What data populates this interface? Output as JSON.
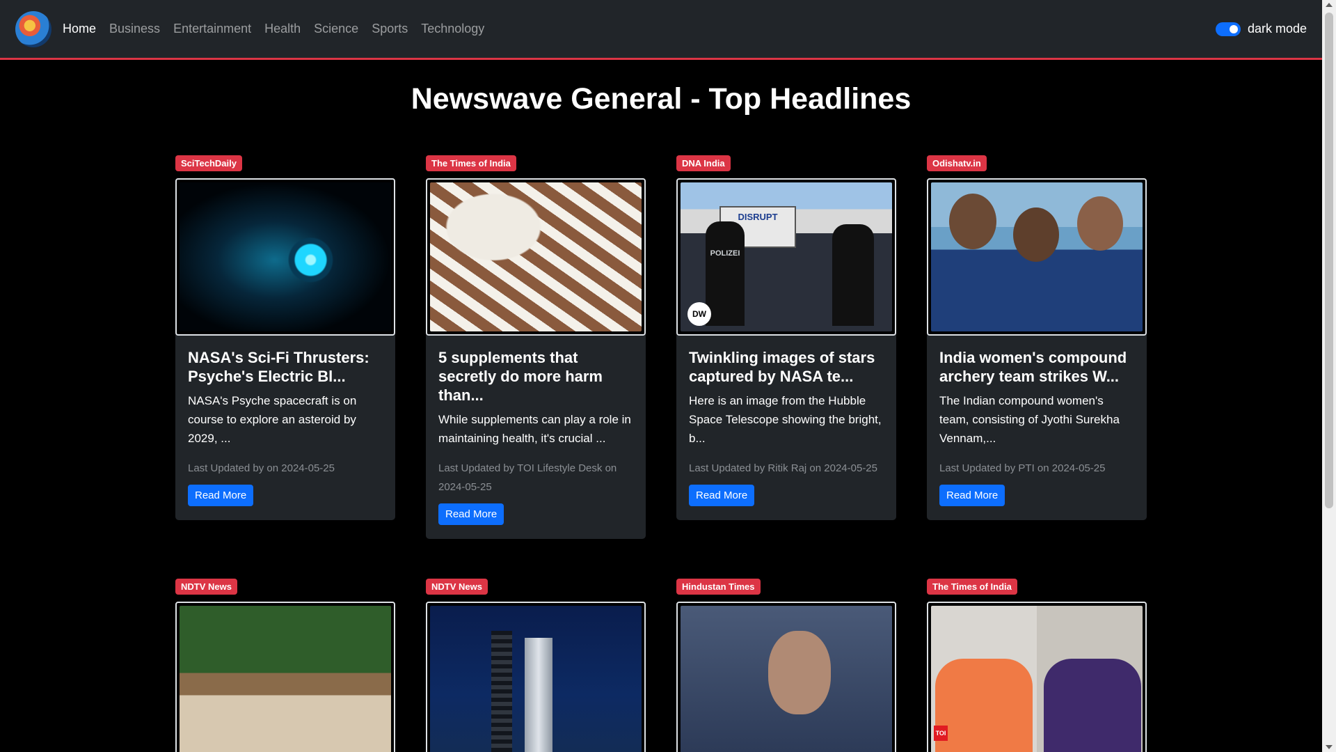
{
  "nav": {
    "links": [
      "Home",
      "Business",
      "Entertainment",
      "Health",
      "Science",
      "Sports",
      "Technology"
    ],
    "active": "Home",
    "toggle_label": "dark mode"
  },
  "page_title": "Newswave General - Top Headlines",
  "cards": [
    {
      "source": "SciTechDaily",
      "title": "NASA's Sci-Fi Thrusters: Psyche's Electric Bl...",
      "description": "NASA's Psyche spacecraft is on course to explore an asteroid by 2029, ...",
      "meta": "Last Updated by on 2024-05-25",
      "button": "Read More"
    },
    {
      "source": "The Times of India",
      "title": "5 supplements that secretly do more harm than...",
      "description": "While supplements can play a role in maintaining health, it's crucial ...",
      "meta": "Last Updated by TOI Lifestyle Desk on 2024-05-25",
      "button": "Read More"
    },
    {
      "source": "DNA India",
      "title": "Twinkling images of stars captured by NASA te...",
      "description": "Here is an image from the Hubble Space Telescope showing the bright, b...",
      "meta": "Last Updated by Ritik Raj on 2024-05-25",
      "button": "Read More"
    },
    {
      "source": "Odishatv.in",
      "title": "India women's compound archery team strikes W...",
      "description": "The Indian compound women's team, consisting of Jyothi Surekha Vennam,...",
      "meta": "Last Updated by PTI on 2024-05-25",
      "button": "Read More"
    },
    {
      "source": "NDTV News"
    },
    {
      "source": "NDTV News"
    },
    {
      "source": "Hindustan Times"
    },
    {
      "source": "The Times of India"
    }
  ],
  "image_marks": {
    "dw_logo": "DW",
    "police_vest": "POLIZEI",
    "toi_logo": "TOI",
    "sign_text": "DISRUPT"
  }
}
